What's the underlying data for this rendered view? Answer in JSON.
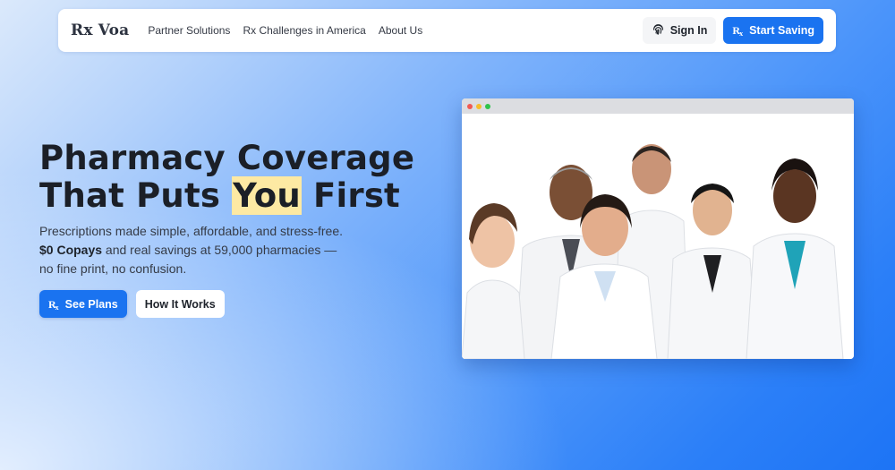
{
  "nav": {
    "logo": "Rx Voa",
    "links": [
      "Partner Solutions",
      "Rx Challenges in America",
      "About Us"
    ],
    "signin_label": "Sign In",
    "start_label": "Start Saving"
  },
  "hero": {
    "headline_line1": "Pharmacy Coverage",
    "headline_pre": "That Puts ",
    "headline_highlight": "You",
    "headline_post": " First",
    "sub_pre": "Prescriptions made simple, affordable, and stress-free. ",
    "sub_bold": "$0 Copays",
    "sub_post": " and real savings at 59,000 pharmacies — no fine print, no confusion.",
    "primary_cta": "See Plans",
    "secondary_cta": "How It Works"
  },
  "colors": {
    "accent": "#1a73f0",
    "highlight": "#fde9a3",
    "dot_red": "#f15a52",
    "dot_yellow": "#f7bd2b",
    "dot_green": "#2fc34b"
  },
  "icons": {
    "signin": "fingerprint-icon",
    "rx": "rx-icon"
  }
}
